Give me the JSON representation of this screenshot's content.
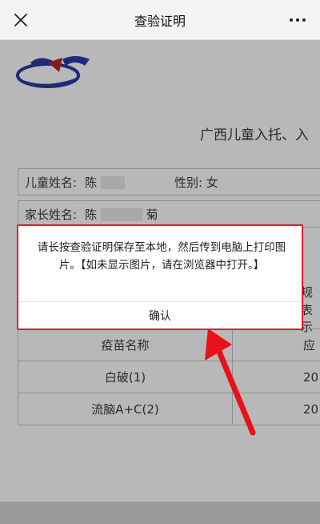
{
  "header": {
    "title": "查验证明",
    "close_icon": "close-icon",
    "more_icon": "more-icon"
  },
  "document": {
    "title": "广西儿童入托、入",
    "child_label": "儿童姓名:",
    "child_name": "陈",
    "gender_label": "性别:",
    "gender_value": "女",
    "parent_label": "家长姓名:",
    "parent_name_first": "陈",
    "parent_name_last": "菊",
    "right_fragment_1": "规",
    "right_fragment_2": "表示",
    "table": {
      "header_name": "疫苗名称",
      "header_date": "应",
      "rows": [
        {
          "name": "白破(1)",
          "date": "20"
        },
        {
          "name": "流脑A+C(2)",
          "date": "20"
        }
      ]
    }
  },
  "modal": {
    "message": "请长按查验证明保存至本地，然后传到电脑上打印图片。【如未显示图片，请在浏览器中打开。】",
    "confirm_label": "确认",
    "border_color": "#d8232a"
  },
  "annotation": {
    "arrow_color": "#e8101a"
  }
}
